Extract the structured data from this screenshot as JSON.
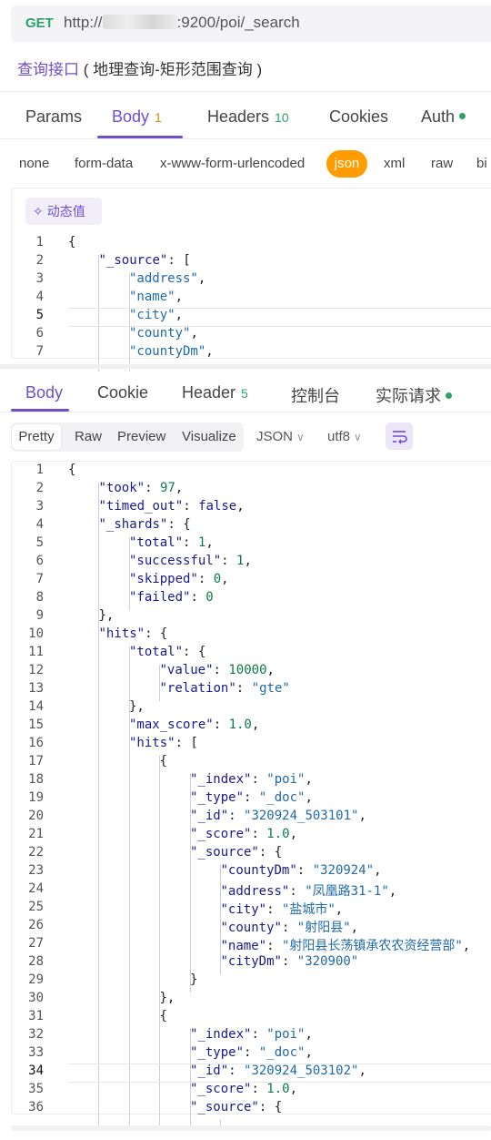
{
  "request": {
    "method": "GET",
    "url_prefix": "http://",
    "url_suffix": ":9200/poi/_search",
    "title_link": "查询接口",
    "title_sub": "( 地理查询-矩形范围查询 )"
  },
  "request_tabs": {
    "params": "Params",
    "body": "Body",
    "body_count": "1",
    "headers": "Headers",
    "headers_count": "10",
    "cookies": "Cookies",
    "auth": "Auth"
  },
  "body_types": [
    "none",
    "form-data",
    "x-www-form-urlencoded",
    "json",
    "xml",
    "raw",
    "bi"
  ],
  "dynamic_value_label": "动态值",
  "request_code": [
    "{",
    "    \"_source\": [",
    "        \"address\",",
    "        \"name\",",
    "        \"city\",",
    "        \"county\",",
    "        \"countyDm\","
  ],
  "response_tabs": {
    "body": "Body",
    "cookie": "Cookie",
    "header": "Header",
    "header_count": "5",
    "console": "控制台",
    "actual_request": "实际请求"
  },
  "view_modes": [
    "Pretty",
    "Raw",
    "Preview",
    "Visualize"
  ],
  "format_select": "JSON",
  "encoding_select": "utf8",
  "response_code": [
    "{",
    "    \"took\": 97,",
    "    \"timed_out\": false,",
    "    \"_shards\": {",
    "        \"total\": 1,",
    "        \"successful\": 1,",
    "        \"skipped\": 0,",
    "        \"failed\": 0",
    "    },",
    "    \"hits\": {",
    "        \"total\": {",
    "            \"value\": 10000,",
    "            \"relation\": \"gte\"",
    "        },",
    "        \"max_score\": 1.0,",
    "        \"hits\": [",
    "            {",
    "                \"_index\": \"poi\",",
    "                \"_type\": \"_doc\",",
    "                \"_id\": \"320924_503101\",",
    "                \"_score\": 1.0,",
    "                \"_source\": {",
    "                    \"countyDm\": \"320924\",",
    "                    \"address\": \"凤凰路31-1\",",
    "                    \"city\": \"盐城市\",",
    "                    \"county\": \"射阳县\",",
    "                    \"name\": \"射阳县长荡镇承农农资经营部\",",
    "                    \"cityDm\": \"320900\"",
    "                }",
    "            },",
    "            {",
    "                \"_index\": \"poi\",",
    "                \"_type\": \"_doc\",",
    "                \"_id\": \"320924_503102\",",
    "                \"_score\": 1.0,",
    "                \"_source\": {"
  ],
  "colors": {
    "accent": "#6f4ec9",
    "method_green": "#2aa36b",
    "json_pill": "#ff9d00"
  }
}
